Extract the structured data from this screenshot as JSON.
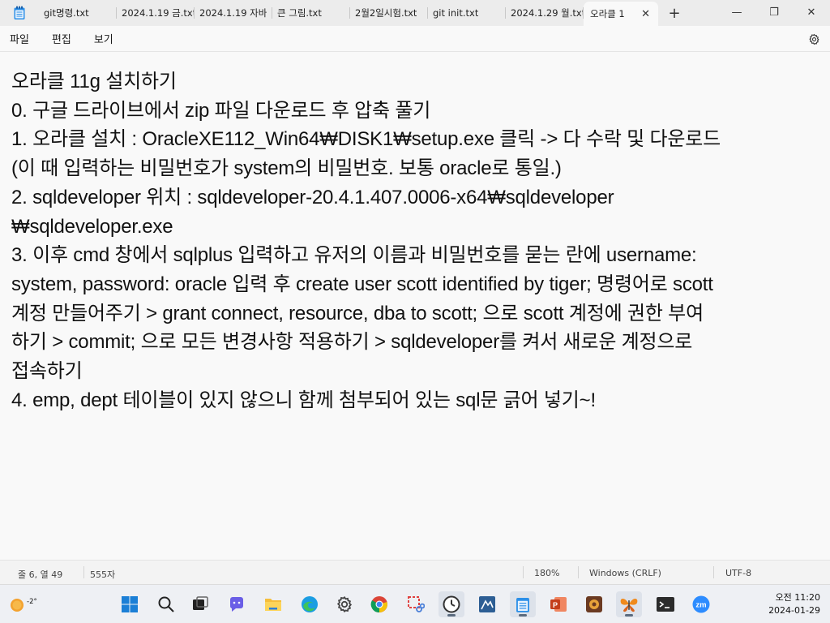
{
  "tabs": [
    {
      "label": "git명령.txt",
      "active": false
    },
    {
      "label": "2024.1.19 금.txt",
      "active": false
    },
    {
      "label": "2024.1.19 자바",
      "active": false
    },
    {
      "label": "큰 그림.txt",
      "active": false
    },
    {
      "label": "2월2일시험.txt",
      "active": false
    },
    {
      "label": "git init.txt",
      "active": false
    },
    {
      "label": "2024.1.29 월.txt",
      "active": false
    },
    {
      "label": "오라클 1",
      "active": true
    }
  ],
  "window": {
    "new_tab": "+",
    "minimize": "—",
    "maximize": "❐",
    "close": "✕",
    "tab_close": "✕"
  },
  "menu": {
    "file": "파일",
    "edit": "편집",
    "view": "보기"
  },
  "editor_lines": [
    "오라클 11g 설치하기",
    "0. 구글 드라이브에서 zip 파일 다운로드 후 압축 풀기",
    "1. 오라클 설치 : OracleXE112_Win64₩DISK1₩setup.exe 클릭 -> 다 수락 및 다운로드",
    "(이 때 입력하는 비밀번호가 system의 비밀번호. 보통 oracle로 통일.)",
    "2. sqldeveloper 위치 : sqldeveloper-20.4.1.407.0006-x64₩sqldeveloper",
    "₩sqldeveloper.exe",
    "3. 이후 cmd 창에서 sqlplus 입력하고 유저의 이름과 비밀번호를 묻는 란에 username:",
    "system, password: oracle 입력 후 create user scott identified by tiger; 명령어로 scott",
    "계정 만들어주기 > grant connect, resource, dba to scott; 으로 scott 계정에 권한 부여",
    "하기 > commit; 으로 모든 변경사항 적용하기 > sqldeveloper를 켜서 새로운 계정으로",
    "접속하기",
    "4. emp, dept 테이블이 있지 않으니 함께 첨부되어 있는 sql문 긁어 넣기~!"
  ],
  "status": {
    "position": "줄 6, 열 49",
    "chars": "555자",
    "zoom": "180%",
    "line_ending": "Windows (CRLF)",
    "encoding": "UTF-8"
  },
  "taskbar": {
    "weather_temp": "-2°",
    "time": "오전 11:20",
    "date": "2024-01-29"
  }
}
